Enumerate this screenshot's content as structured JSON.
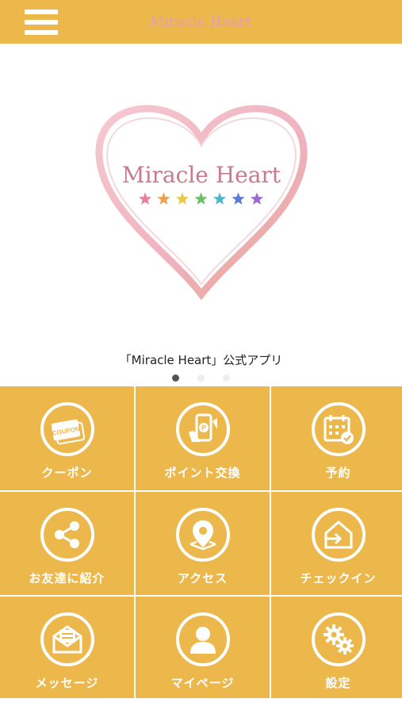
{
  "header": {
    "title": "Miracle Heart",
    "menu_icon": "hamburger-menu-icon",
    "background": "#ecb84c"
  },
  "slider": {
    "logo_text": "Miracle Heart",
    "star_colors": [
      "#e87f9f",
      "#f0a04a",
      "#e8c84a",
      "#6cc06a",
      "#4fb8c8",
      "#5a7ad8",
      "#9a6ad0"
    ],
    "caption": "「Miracle Heart」公式アプリ",
    "active_slide": 1,
    "slide_count": 3
  },
  "menu": [
    {
      "label": "クーポン",
      "icon": "coupon-icon"
    },
    {
      "label": "ポイント交換",
      "icon": "point-exchange-icon"
    },
    {
      "label": "予約",
      "icon": "calendar-reservation-icon"
    },
    {
      "label": "お友達に紹介",
      "icon": "share-icon"
    },
    {
      "label": "アクセス",
      "icon": "map-pin-icon"
    },
    {
      "label": "チェックイン",
      "icon": "checkin-icon"
    },
    {
      "label": "メッセージ",
      "icon": "message-envelope-icon"
    },
    {
      "label": "マイページ",
      "icon": "user-icon"
    },
    {
      "label": "設定",
      "icon": "gear-icon"
    }
  ],
  "colors": {
    "accent": "#ecb84c",
    "title_pink": "#e3a0aa",
    "logo_text": "#c97a8c"
  }
}
